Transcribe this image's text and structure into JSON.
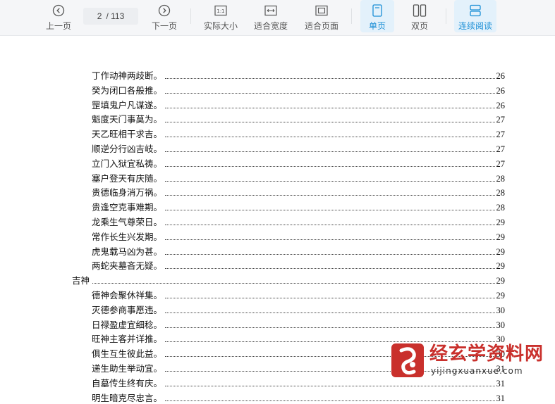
{
  "toolbar": {
    "prev": "上一页",
    "current_page": "2",
    "total_pages": "/ 113",
    "next": "下一页",
    "actual_size": "实际大小",
    "fit_width": "适合宽度",
    "fit_page": "适合页面",
    "single_page": "单页",
    "double_page": "双页",
    "continuous": "连续阅读"
  },
  "toc": [
    {
      "title": "丁作动神两歧断。",
      "page": "26",
      "indent": 1
    },
    {
      "title": "癸为闭口各般推。",
      "page": "26",
      "indent": 1
    },
    {
      "title": "罡填鬼户凡谋遂。",
      "page": "26",
      "indent": 1
    },
    {
      "title": "魁度天门事莫为。",
      "page": "27",
      "indent": 1
    },
    {
      "title": "天乙旺相干求吉。",
      "page": "27",
      "indent": 1
    },
    {
      "title": "顺逆分行凶吉岐。",
      "page": "27",
      "indent": 1
    },
    {
      "title": "立门入狱宜私祷。",
      "page": "27",
      "indent": 1
    },
    {
      "title": "塞户登天有庆随。",
      "page": "28",
      "indent": 1
    },
    {
      "title": "贵德临身消万祸。",
      "page": "28",
      "indent": 1
    },
    {
      "title": "贵逢空克事难期。",
      "page": "28",
      "indent": 1
    },
    {
      "title": "龙乘生气尊荣日。",
      "page": "29",
      "indent": 1
    },
    {
      "title": "常作长生兴发期。",
      "page": "29",
      "indent": 1
    },
    {
      "title": "虎鬼载马凶为甚。",
      "page": "29",
      "indent": 1
    },
    {
      "title": "两蛇夹墓吝无疑。",
      "page": "29",
      "indent": 1
    },
    {
      "title": "吉神",
      "page": "29",
      "indent": 0
    },
    {
      "title": "德神会聚休祥集。",
      "page": "29",
      "indent": 1
    },
    {
      "title": "灭德参商事愿违。",
      "page": "30",
      "indent": 1
    },
    {
      "title": "日禄盈虚宜细稔。",
      "page": "30",
      "indent": 1
    },
    {
      "title": "旺神主客并详推。",
      "page": "30",
      "indent": 1
    },
    {
      "title": "俱生互生彼此益。",
      "page": "30",
      "indent": 1
    },
    {
      "title": "递生助生举动宜。",
      "page": "31",
      "indent": 1
    },
    {
      "title": "自墓传生终有庆。",
      "page": "31",
      "indent": 1
    },
    {
      "title": "明生暗克尽忠言。",
      "page": "31",
      "indent": 1
    }
  ],
  "watermark": {
    "brand": "经玄学资料网",
    "url": "yijingxuanxue.com"
  },
  "colors": {
    "accent": "#1b8fd6",
    "watermark": "#c9302c"
  }
}
